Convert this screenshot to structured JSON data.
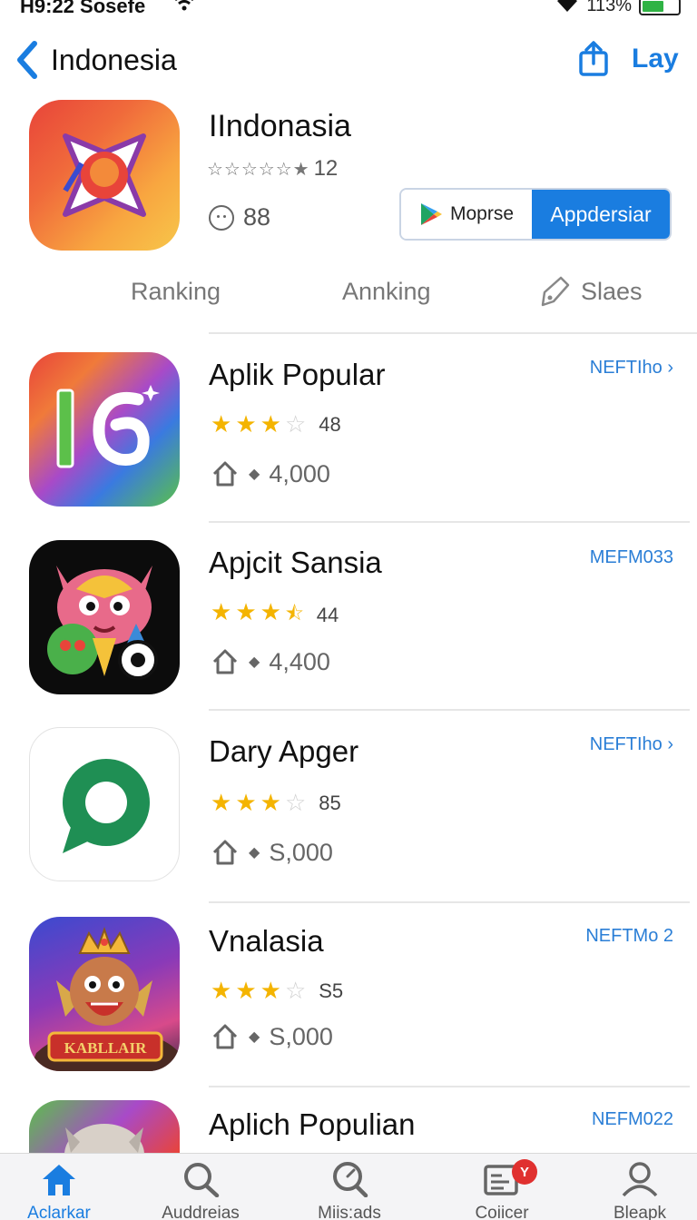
{
  "status_bar": {
    "time": "H9:22 Sosefe",
    "battery": "113%",
    "battery_level": 0.55
  },
  "nav": {
    "back_label": "Indonesia",
    "action_label": "Lay"
  },
  "header": {
    "title": "IIndonasia",
    "stars": "☆☆☆☆☆★",
    "rating": "12",
    "count": "88",
    "store_button": "Moprse",
    "primary_button": "Appdersiar"
  },
  "tabs": [
    {
      "label": "Ranking"
    },
    {
      "label": "Annking"
    },
    {
      "label": "Slaes"
    }
  ],
  "apps": [
    {
      "title": "Aplik Popular",
      "link": "NEFTIho ›",
      "rating": "48",
      "stars_full": 3,
      "stars_total": 4,
      "downloads": "4,000"
    },
    {
      "title": "Apjcit Sansia",
      "link": "MEFM033",
      "rating": "44",
      "stars_full": 3.5,
      "stars_total": 4,
      "downloads": "4,400"
    },
    {
      "title": "Dary Apger",
      "link": "NEFTIho ›",
      "rating": "85",
      "stars_full": 3,
      "stars_total": 4,
      "downloads": "S,000"
    },
    {
      "title": "Vnalasia",
      "link": "NEFTMo 2",
      "rating": "S5",
      "stars_full": 3,
      "stars_total": 4,
      "downloads": "S,000"
    },
    {
      "title": "Aplich Populian",
      "link": "NEFM022"
    }
  ],
  "icon_texts": {
    "app5_banner": "KABLLAIR"
  },
  "tab_bar": {
    "items": [
      {
        "label": "Aclarkar",
        "icon": "home-icon",
        "active": true
      },
      {
        "label": "Auddreias",
        "icon": "search-icon"
      },
      {
        "label": "Miis:ads",
        "icon": "search-gauge-icon"
      },
      {
        "label": "Coiicer",
        "icon": "news-icon",
        "badge": "Y"
      },
      {
        "label": "Bleapk",
        "icon": "person-icon"
      }
    ]
  },
  "colors": {
    "accent": "#1a7de0",
    "star": "#f4b400",
    "badge": "#e0302f"
  }
}
